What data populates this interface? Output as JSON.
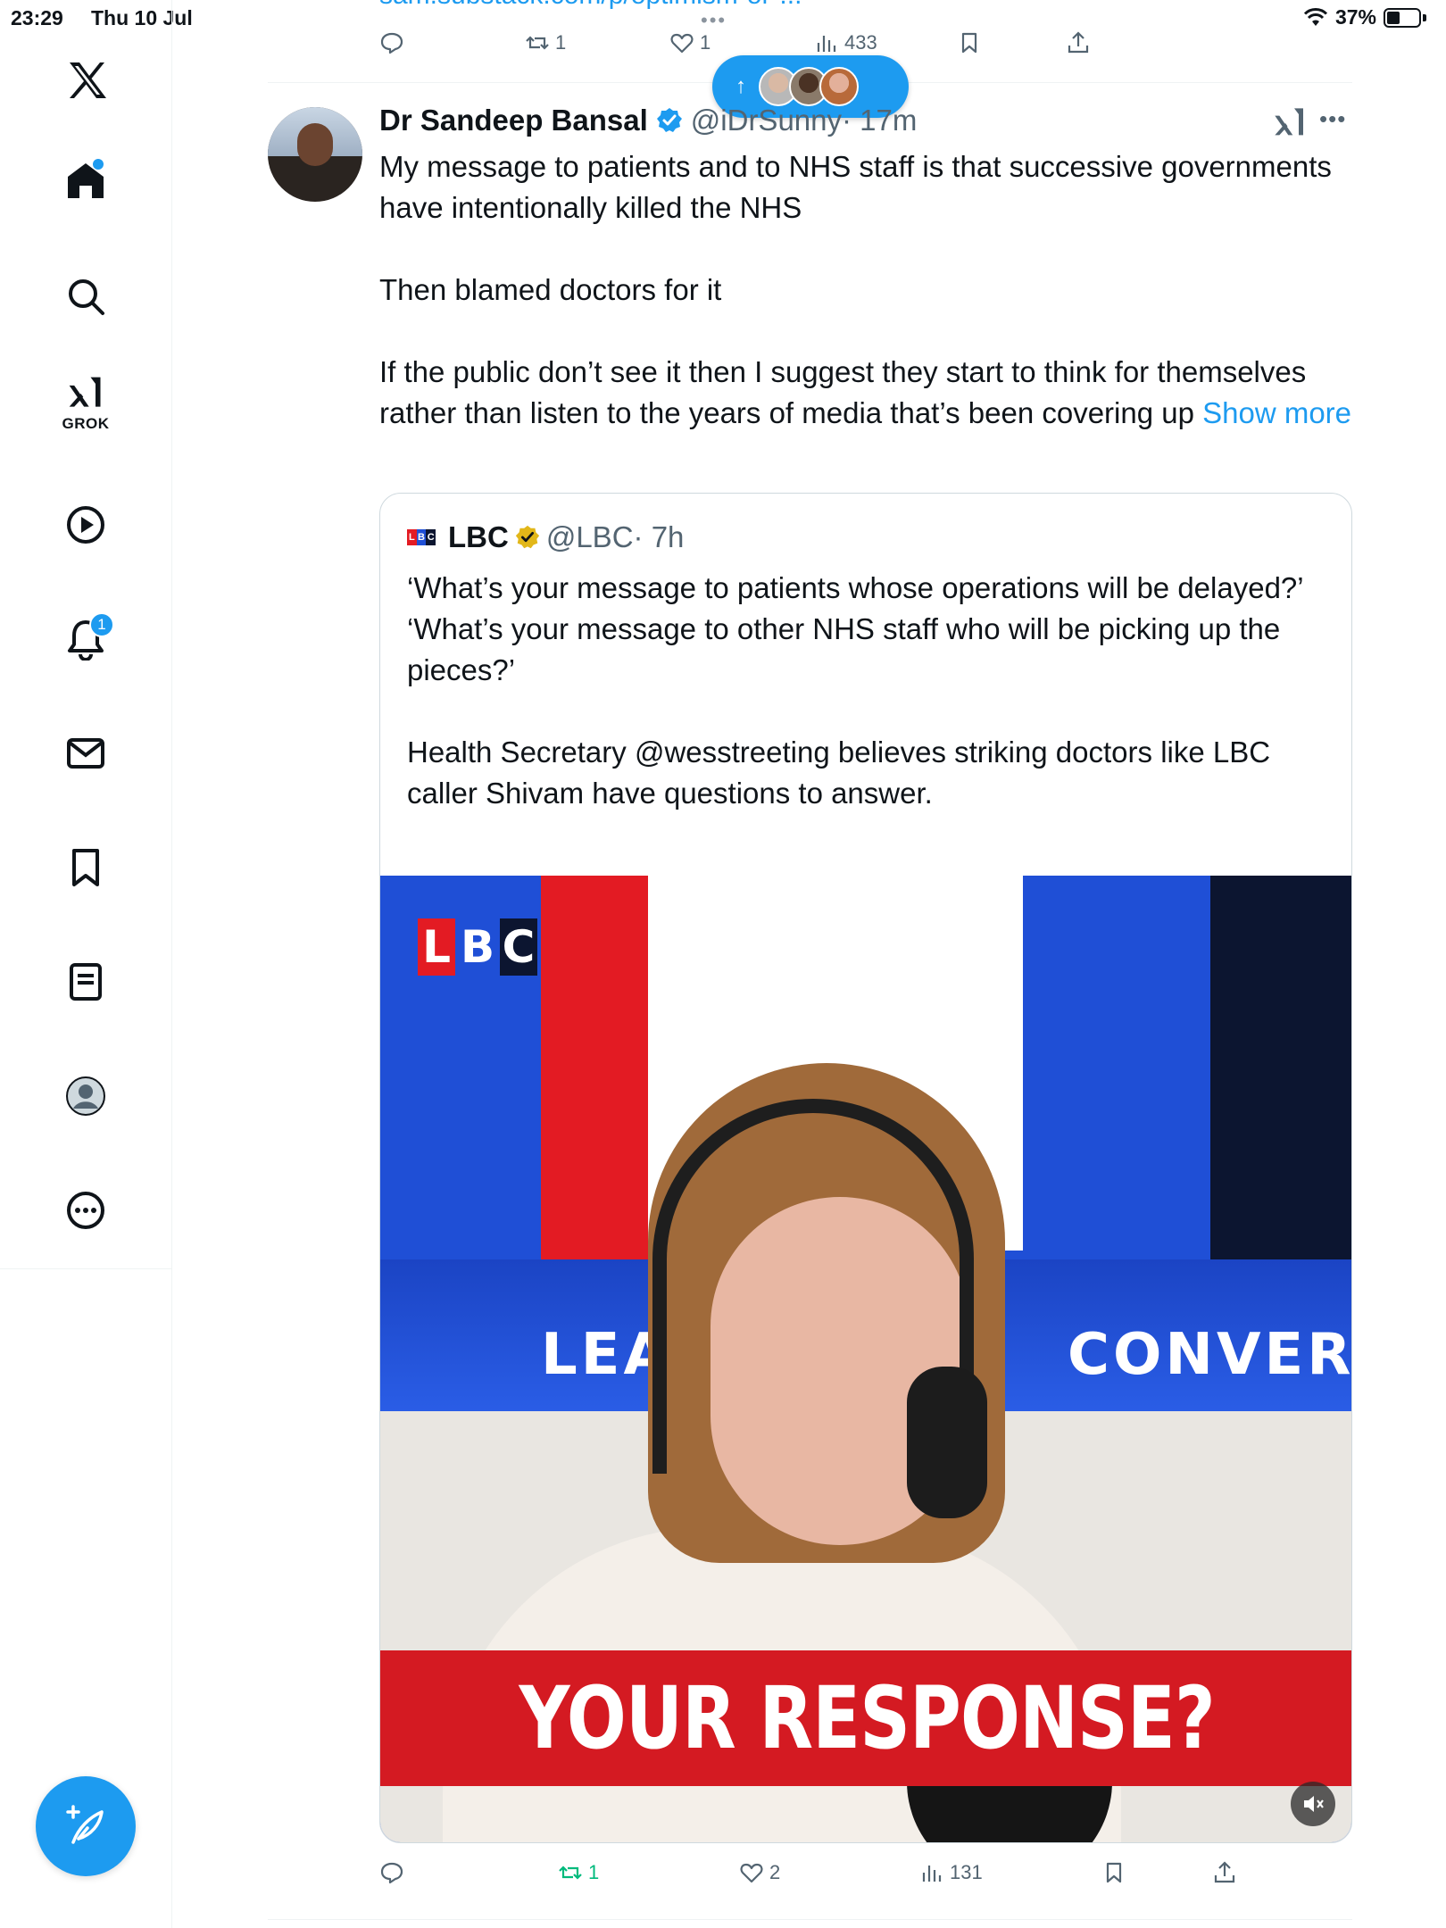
{
  "status_bar": {
    "time": "23:29",
    "date": "Thu 10 Jul",
    "battery": "37%",
    "multitask_dots": "•••"
  },
  "sidebar": {
    "items": [
      {
        "name": "x-logo",
        "icon": "x-logo-icon"
      },
      {
        "name": "home",
        "icon": "home-icon",
        "has_dot": true
      },
      {
        "name": "explore",
        "icon": "search-icon"
      },
      {
        "name": "grok",
        "icon": "grok-icon",
        "label": "GROK"
      },
      {
        "name": "video",
        "icon": "play-icon"
      },
      {
        "name": "notifications",
        "icon": "bell-icon",
        "badge": "1"
      },
      {
        "name": "messages",
        "icon": "mail-icon"
      },
      {
        "name": "bookmarks",
        "icon": "bookmark-icon"
      },
      {
        "name": "lists",
        "icon": "list-icon"
      },
      {
        "name": "profile",
        "icon": "profile-icon"
      },
      {
        "name": "more",
        "icon": "more-icon"
      }
    ],
    "compose_icon": "compose-icon"
  },
  "previous_tweet": {
    "link_text": "sam.substack.com/p/optimism-or-...",
    "retweets": "1",
    "likes": "1",
    "views": "433"
  },
  "new_posts_pill": {
    "arrow": "↑"
  },
  "tweet": {
    "author_name": "Dr Sandeep Bansal",
    "handle": "@iDrSunny",
    "time": "· 17m",
    "text_1": "My message to patients and to NHS staff is that successive governments have intentionally killed the NHS\n\nThen blamed doctors for it\n\nIf the public don’t see it then I suggest they start to think for themselves rather than listen to the years of media that’s been covering up ",
    "show_more": "Show more",
    "more_options": "•••",
    "quote": {
      "author_name": "LBC",
      "handle": "@LBC",
      "time": "· 7h",
      "text": "‘What’s your message to patients whose operations will be delayed?’\n‘What’s your message to other NHS staff who will be picking up the pieces?’\n\nHealth Secretary @wesstreeting believes striking doctors like LBC caller Shivam have questions to answer.",
      "video": {
        "corner_logo": [
          "L",
          "B",
          "C"
        ],
        "bg_text_left": "LEA",
        "bg_text_right": "CONVERSAT",
        "banner_text": "YOUR RESPONSE?"
      }
    },
    "actions": {
      "replies": "",
      "retweets": "1",
      "likes": "2",
      "views": "131"
    }
  },
  "colors": {
    "accent": "#1d9bf0",
    "retweeted_green": "#00ba7c",
    "lbc_red": "#e31b23",
    "lbc_blue": "#1f4fd6",
    "verified_gold": "#e2b719"
  }
}
